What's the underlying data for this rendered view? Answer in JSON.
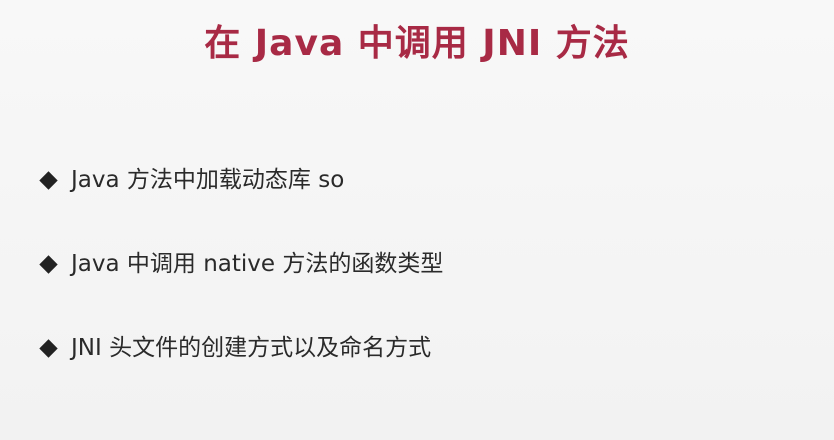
{
  "slide": {
    "title": "在 Java 中调用 JNI 方法",
    "bullets": [
      {
        "icon": "diamond-bullet-icon",
        "text": "Java 方法中加载动态库 so"
      },
      {
        "icon": "diamond-bullet-icon",
        "text": "Java 中调用 native 方法的函数类型"
      },
      {
        "icon": "diamond-bullet-icon",
        "text": "JNI 头文件的创建方式以及命名方式"
      }
    ],
    "colors": {
      "title": "#a82a45",
      "text": "#2a2a2a",
      "background": "#f7f7f7"
    }
  }
}
